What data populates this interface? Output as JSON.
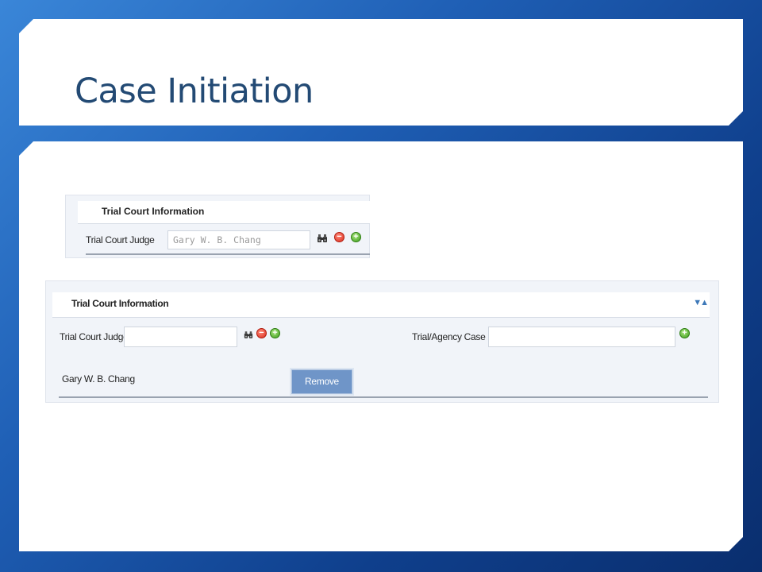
{
  "slide": {
    "title": "Case Initiation"
  },
  "old_form": {
    "section_header": "Trial Court Information",
    "judge_label": "Trial Court Judge",
    "judge_value": "Gary W. B. Chang",
    "icons": [
      "binoculars-icon",
      "remove-icon",
      "add-icon"
    ]
  },
  "new_form": {
    "section_header": "Trial Court Information",
    "judge_label": "Trial Court Judge",
    "judge_value": "",
    "case_id_label": "Trial/Agency Case Id",
    "case_id_value": "",
    "selected_judge": "Gary W. B. Chang",
    "remove_button": "Remove",
    "icons": [
      "binoculars-icon",
      "remove-icon",
      "add-icon",
      "add-icon",
      "collapse-arrows-icon"
    ]
  },
  "colors": {
    "title_text": "#234a74",
    "background_blue": "#1f5fb5",
    "remove_button": "#6f95c8",
    "add_green": "#3f9f1e",
    "remove_red": "#d92b1c"
  }
}
